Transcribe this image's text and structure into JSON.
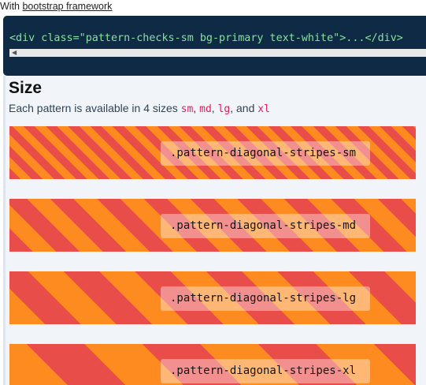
{
  "intro": {
    "prefix": "With ",
    "link_text": "bootstrap framework"
  },
  "code_example": {
    "code": "<div class=\"pattern-checks-sm bg-primary text-white\">...</div>",
    "scroll_left_icon": "triangle-left-icon"
  },
  "size_section": {
    "title": "Size",
    "desc_prefix": "Each pattern is available in 4 sizes ",
    "sizes": [
      "sm",
      "md",
      "lg",
      "xl"
    ],
    "sep1": ", ",
    "sep2": ", ",
    "sep3": ", and "
  },
  "examples": [
    {
      "label": ".pattern-diagonal-stripes-sm"
    },
    {
      "label": ".pattern-diagonal-stripes-md"
    },
    {
      "label": ".pattern-diagonal-stripes-lg"
    },
    {
      "label": ".pattern-diagonal-stripes-xl"
    }
  ],
  "colors": {
    "stripe_red": "#e94d4a",
    "stripe_orange": "#fd8b1f",
    "code_bg": "#0f2a44",
    "code_text": "#86e39a",
    "size_code": "#e0205a"
  }
}
